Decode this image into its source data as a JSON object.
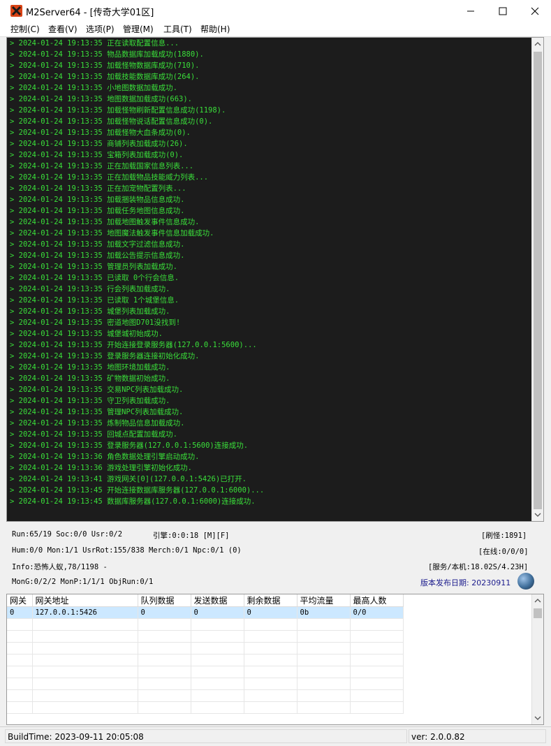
{
  "window": {
    "title": "M2Server64 - [传奇大学01区]"
  },
  "menu": [
    "控制(C)",
    "查看(V)",
    "选项(P)",
    "管理(M)",
    "工具(T)",
    "帮助(H)"
  ],
  "log": [
    "> 2024-01-24 19:13:35 正在读取配置信息...",
    "> 2024-01-24 19:13:35 物品数据库加载成功(1880).",
    "> 2024-01-24 19:13:35 加载怪物数据库成功(710).",
    "> 2024-01-24 19:13:35 加载技能数据库成功(264).",
    "> 2024-01-24 19:13:35 小地图数据加载成功.",
    "> 2024-01-24 19:13:35 地图数据加载成功(663).",
    "> 2024-01-24 19:13:35 加载怪物刷新配置信息成功(1198).",
    "> 2024-01-24 19:13:35 加载怪物说话配置信息成功(0).",
    "> 2024-01-24 19:13:35 加载怪物大血条成功(0).",
    "> 2024-01-24 19:13:35 商铺列表加载成功(26).",
    "> 2024-01-24 19:13:35 宝箱列表加载成功(0).",
    "> 2024-01-24 19:13:35 正在加载国家信息列表...",
    "> 2024-01-24 19:13:35 正在加载物品技能威力列表...",
    "> 2024-01-24 19:13:35 正在加宠物配置列表...",
    "> 2024-01-24 19:13:35 加载捆装物品信息成功.",
    "> 2024-01-24 19:13:35 加载任务地图信息成功.",
    "> 2024-01-24 19:13:35 加载地图触发事件信息成功.",
    "> 2024-01-24 19:13:35 地图魔法触发事件信息加载成功.",
    "> 2024-01-24 19:13:35 加载文字过滤信息成功.",
    "> 2024-01-24 19:13:35 加载公告提示信息成功.",
    "> 2024-01-24 19:13:35 管理员列表加载成功.",
    "> 2024-01-24 19:13:35 已读取 0个行会信息.",
    "> 2024-01-24 19:13:35 行会列表加载成功.",
    "> 2024-01-24 19:13:35 已读取 1个城堡信息.",
    "> 2024-01-24 19:13:35 城堡列表加载成功.",
    "> 2024-01-24 19:13:35 密道地图D701没找到!",
    "> 2024-01-24 19:13:35 城堡城初始成功.",
    "> 2024-01-24 19:13:35 开始连接登录服务器(127.0.0.1:5600)...",
    "> 2024-01-24 19:13:35 登录服务器连接初始化成功.",
    "> 2024-01-24 19:13:35 地图环境加载成功.",
    "> 2024-01-24 19:13:35 矿物数据初始成功.",
    "> 2024-01-24 19:13:35 交易NPC列表加载成功.",
    "> 2024-01-24 19:13:35 守卫列表加载成功.",
    "> 2024-01-24 19:13:35 管理NPC列表加载成功.",
    "> 2024-01-24 19:13:35 炼制物品信息加载成功.",
    "> 2024-01-24 19:13:35 回城点配置加载成功.",
    "> 2024-01-24 19:13:35 登录服务器(127.0.0.1:5600)连接成功.",
    "> 2024-01-24 19:13:36 角色数据处理引擎启动成功.",
    "> 2024-01-24 19:13:36 游戏处理引擎初始化成功.",
    "> 2024-01-24 19:13:41 游戏网关[0](127.0.0.1:5426)已打开.",
    "> 2024-01-24 19:13:45 开始连接数据库服务器(127.0.0.1:6000)...",
    "> 2024-01-24 19:13:45 数据库服务器(127.0.0.1:6000)连接成功."
  ],
  "status": {
    "run": "Run:65/19 Soc:0/0 Usr:0/2",
    "engine": "引擎:0:0:18 [M][F]",
    "refresh": "[刷怪:1891]",
    "hum": "Hum:0/0 Mon:1/1 UsrRot:155/838 Merch:0/1 Npc:0/1 (0)",
    "online": "[在线:0/0/0]",
    "info": "Info:恐怖人蚁,78/1198 -",
    "service": "[服务/本机:18.02S/4.23H]",
    "mong": "MonG:0/2/2 MonP:1/1/1 ObjRun:0/1",
    "release": "版本发布日期: 20230911"
  },
  "gateway_table": {
    "columns": [
      "网关",
      "网关地址",
      "队列数据",
      "发送数据",
      "剩余数据",
      "平均流量",
      "最高人数"
    ],
    "rows": [
      [
        "0",
        "127.0.0.1:5426",
        "0",
        "0",
        "0",
        "0b",
        "0/0"
      ]
    ]
  },
  "statusbar": {
    "build": "BuildTime: 2023-09-11 20:05:08",
    "version": "ver: 2.0.0.82"
  },
  "colors": {
    "log_text": "#3adf3a",
    "log_bg": "#1c1c1c",
    "release_text": "#1a1a8c",
    "selected_row": "#cce8ff"
  }
}
